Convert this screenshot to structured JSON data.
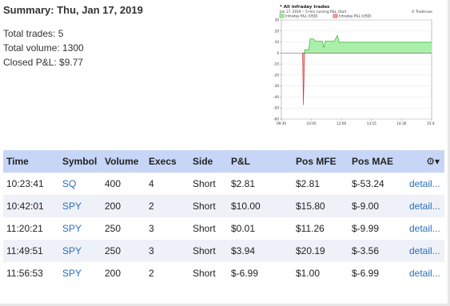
{
  "summary": {
    "title": "Summary: Thu, Jan 17, 2019",
    "total_trades": "Total trades: 5",
    "total_volume": "Total volume: 1300",
    "closed_pnl": "Closed P&L: $9.77"
  },
  "chart_data": {
    "type": "area",
    "title": "* All infraday trades",
    "subtitle": "Jan 17, 2019 -- 5-min running P&L chart",
    "credit": "© Tradervue",
    "legend": [
      "Intraday P&L (USD)",
      "Intraday P&L (USD)"
    ],
    "colors": {
      "positive": "#aaf0aa",
      "positive_stroke": "#33b533",
      "negative": "#f2a7a7",
      "negative_stroke": "#cc3333"
    },
    "ylim": [
      -60,
      30
    ],
    "y_ticks": [
      30,
      20,
      10,
      0,
      -10,
      -20,
      -30,
      -40,
      -50,
      -60
    ],
    "x_ticks": [
      "09:30",
      "10:45",
      "12:00",
      "13:15",
      "14:30",
      "15:45"
    ],
    "points": [
      [
        "10:23",
        0
      ],
      [
        "10:25",
        -47
      ],
      [
        "10:28",
        2.8
      ],
      [
        "10:38",
        2.8
      ],
      [
        "10:42",
        12.8
      ],
      [
        "10:50",
        12.8
      ],
      [
        "10:55",
        10.8
      ],
      [
        "11:12",
        10.8
      ],
      [
        "11:16",
        5
      ],
      [
        "11:20",
        10.8
      ],
      [
        "11:42",
        10.8
      ],
      [
        "11:50",
        16
      ],
      [
        "11:54",
        9.77
      ],
      [
        "15:59",
        9.77
      ]
    ]
  },
  "table": {
    "headers": [
      "Time",
      "Symbol",
      "Volume",
      "Execs",
      "Side",
      "P&L",
      "Pos MFE",
      "Pos MAE"
    ],
    "gear_icon": "gear-icon",
    "rows": [
      [
        "10:23:41",
        "SQ",
        "400",
        "4",
        "Short",
        "$2.81",
        "$2.81",
        "$-53.24",
        "detail..."
      ],
      [
        "10:42:01",
        "SPY",
        "200",
        "2",
        "Short",
        "$10.00",
        "$15.80",
        "$-9.00",
        "detail..."
      ],
      [
        "11:20:21",
        "SPY",
        "250",
        "3",
        "Short",
        "$0.01",
        "$11.26",
        "$-9.99",
        "detail..."
      ],
      [
        "11:49:51",
        "SPY",
        "250",
        "3",
        "Short",
        "$3.94",
        "$20.19",
        "$-3.56",
        "detail..."
      ],
      [
        "11:56:53",
        "SPY",
        "200",
        "2",
        "Short",
        "$-6.99",
        "$1.00",
        "$-6.99",
        "detail..."
      ]
    ]
  }
}
